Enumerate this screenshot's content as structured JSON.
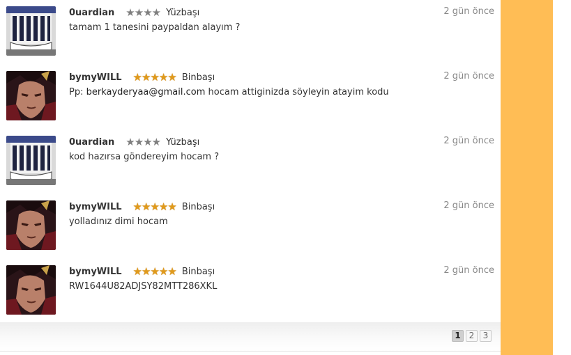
{
  "comments": [
    {
      "username": "0uardian",
      "stars": 4,
      "rank": "Yüzbaşı",
      "time": "2 gün önce",
      "text": "tamam 1 tanesini paypaldan alayım ?",
      "avatar_icon": "guardian-avatar"
    },
    {
      "username": "bymyWILL",
      "stars": 5,
      "rank": "Binbaşı",
      "time": "2 gün önce",
      "text_prefix": "Pp: ",
      "email": "berkayderyaa@gmail.com",
      "text_suffix": " hocam attiginizda söyleyin atayim kodu",
      "avatar_icon": "warrior-avatar"
    },
    {
      "username": "0uardian",
      "stars": 4,
      "rank": "Yüzbaşı",
      "time": "2 gün önce",
      "text": "kod hazırsa göndereyim hocam ?",
      "avatar_icon": "guardian-avatar"
    },
    {
      "username": "bymyWILL",
      "stars": 5,
      "rank": "Binbaşı",
      "time": "2 gün önce",
      "text": "yolladınız dimi hocam",
      "avatar_icon": "warrior-avatar"
    },
    {
      "username": "bymyWILL",
      "stars": 5,
      "rank": "Binbaşı",
      "time": "2 gün önce",
      "text": "RW1644U82ADJSY82MTT286XKL",
      "avatar_icon": "warrior-avatar"
    }
  ],
  "pagination": {
    "pages": [
      "1",
      "2",
      "3"
    ],
    "current": "1"
  },
  "colors": {
    "side_panel": "#ffbd55",
    "star_gold": "#e09a1b",
    "star_gray": "#7f7f7f"
  }
}
